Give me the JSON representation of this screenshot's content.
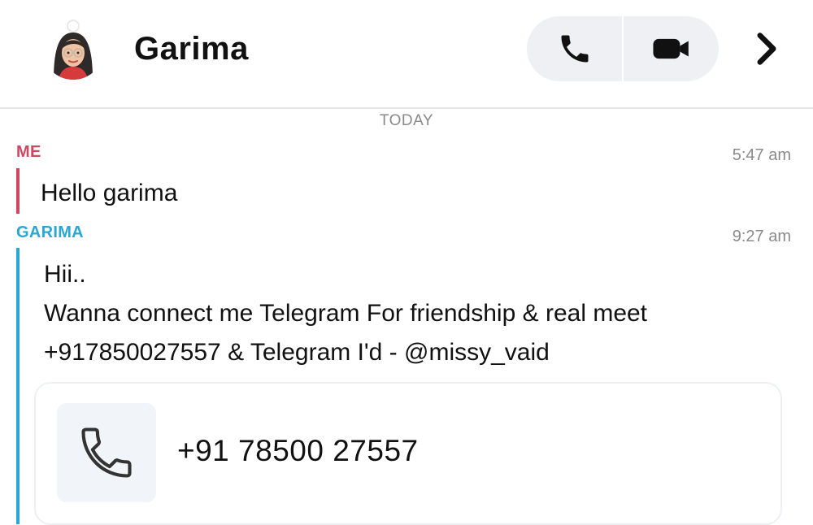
{
  "header": {
    "contact_name": "Garima",
    "avatar_icon": "bitmoji-avatar",
    "actions": [
      {
        "name": "voice-call",
        "icon": "phone-icon"
      },
      {
        "name": "video-call",
        "icon": "video-camera-icon"
      },
      {
        "name": "open-profile",
        "icon": "chevron-right-icon"
      }
    ]
  },
  "chat": {
    "date_separator": "TODAY",
    "messages": [
      {
        "sender": "ME",
        "time": "5:47 am",
        "color": "#d2465f",
        "lines": [
          "Hello garima"
        ]
      },
      {
        "sender": "GARIMA",
        "time": "9:27 am",
        "color": "#2aa7d4",
        "lines": [
          "Hii..",
          "Wanna connect  me Telegram For friendship & real meet",
          "+917850027557 & Telegram I'd - @missy_vaid"
        ]
      }
    ],
    "phone_card": {
      "icon": "phone-icon",
      "number": "+91 78500 27557"
    }
  }
}
